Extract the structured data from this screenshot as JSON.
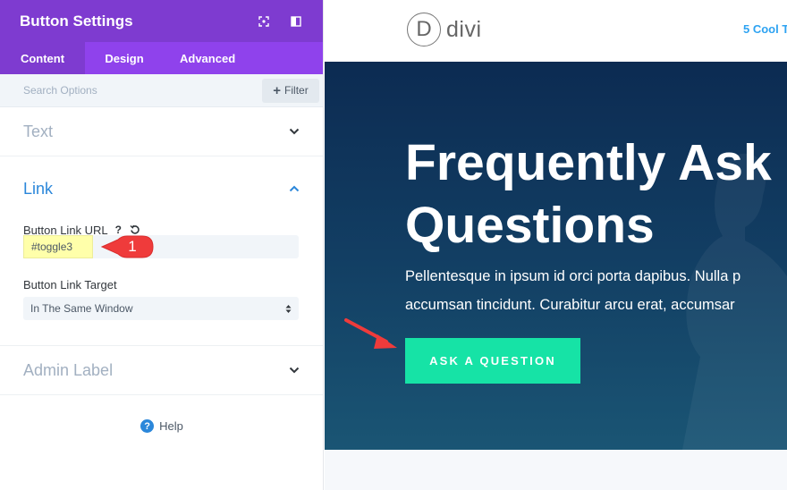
{
  "panel": {
    "title": "Button Settings",
    "header_icons": [
      "focus-icon",
      "split-view-icon"
    ],
    "tabs": [
      {
        "label": "Content",
        "active": true
      },
      {
        "label": "Design",
        "active": false
      },
      {
        "label": "Advanced",
        "active": false
      }
    ],
    "search": {
      "placeholder": "Search Options",
      "filter_label": "Filter"
    },
    "sections": {
      "text": {
        "title": "Text",
        "expanded": false
      },
      "link": {
        "title": "Link",
        "expanded": true,
        "url_label": "Button Link URL",
        "url_help": "?",
        "url_value": "#toggle3",
        "target_label": "Button Link Target",
        "target_value": "In The Same Window"
      },
      "admin": {
        "title": "Admin Label",
        "expanded": false
      }
    },
    "help": "Help",
    "callout_number": "1"
  },
  "page": {
    "logo_letter": "D",
    "logo_text": "divi",
    "nav_link": "5 Cool T",
    "hero_title_line1": "Frequently Ask",
    "hero_title_line2": "Questions",
    "hero_desc_line1": "Pellentesque in ipsum id orci porta dapibus. Nulla p",
    "hero_desc_line2": "accumsan tincidunt. Curabitur arcu erat, accumsar",
    "cta_label": "ASK A QUESTION"
  },
  "colors": {
    "header_purple": "#7e3bd0",
    "tab_purple": "#8f42ec",
    "link_blue": "#2b87da",
    "cta_green": "#16e3a6",
    "hero_navy": "#0c2b52",
    "annotation_red": "#ef3b3b",
    "highlight_yellow": "#ffffaa"
  }
}
